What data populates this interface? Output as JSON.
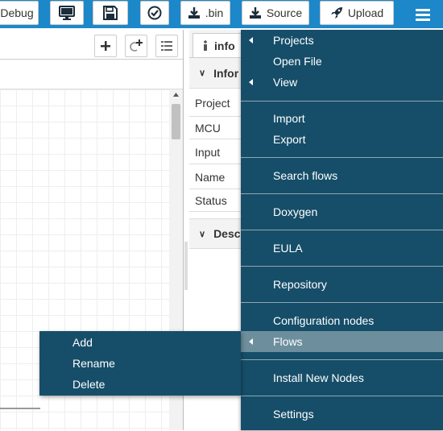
{
  "toolbar": {
    "debug_label": "Debug",
    "bin_label": ".bin",
    "source_label": "Source",
    "upload_label": "Upload"
  },
  "info_tab": {
    "label": "info"
  },
  "info_panel": {
    "section_info": "Infor",
    "section_desc": "Desc",
    "rows": [
      "Project",
      "MCU",
      "Input",
      "Name",
      "Status"
    ]
  },
  "main_menu": {
    "items": [
      "Projects",
      "Open File",
      "View",
      "Import",
      "Export",
      "Search flows",
      "Doxygen",
      "EULA",
      "Repository",
      "Configuration nodes",
      "Flows",
      "Install New Nodes",
      "Settings"
    ]
  },
  "context_menu": {
    "items": [
      "Add",
      "Rename",
      "Delete"
    ]
  },
  "colors": {
    "header": "#1c87c9",
    "menu_bg": "#164e69",
    "menu_highlight": "#6d8e9d"
  }
}
